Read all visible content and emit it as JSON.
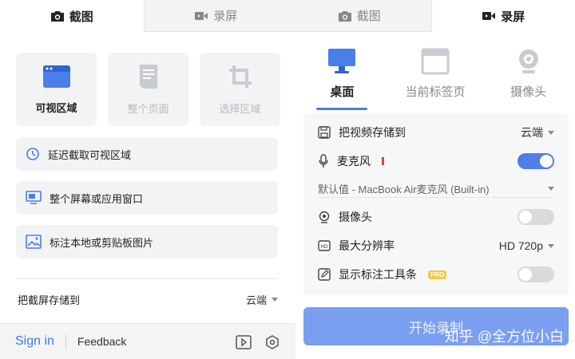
{
  "top_tabs": [
    {
      "label": "截图",
      "icon": "camera-icon"
    },
    {
      "label": "录屏",
      "icon": "video-icon"
    },
    {
      "label": "截图",
      "icon": "camera-icon"
    },
    {
      "label": "录屏",
      "icon": "video-icon"
    }
  ],
  "screenshot": {
    "modes": [
      {
        "label": "可视区域",
        "icon": "browser-window-icon",
        "state": "active"
      },
      {
        "label": "整个页面",
        "icon": "full-page-icon",
        "state": "disabled"
      },
      {
        "label": "选择区域",
        "icon": "crop-icon",
        "state": "disabled"
      }
    ],
    "options": [
      {
        "label": "延迟截取可视区域",
        "icon": "timer-icon"
      },
      {
        "label": "整个屏幕或应用窗口",
        "icon": "monitor-icon"
      },
      {
        "label": "标注本地或剪贴板图片",
        "icon": "image-icon"
      }
    ],
    "save_label": "把截屏存储到",
    "save_value": "云端"
  },
  "footer": {
    "signin": "Sign in",
    "feedback": "Feedback"
  },
  "record": {
    "tabs": [
      {
        "label": "桌面",
        "icon": "desktop-icon"
      },
      {
        "label": "当前标签页",
        "icon": "browser-tab-icon"
      },
      {
        "label": "摄像头",
        "icon": "webcam-icon"
      }
    ],
    "save_label": "把视频存储到",
    "save_value": "云端",
    "mic_label": "麦克风",
    "mic_on": true,
    "mic_device": "默认值 - MacBook Air麦克风 (Built-in)",
    "camera_label": "摄像头",
    "camera_on": false,
    "resolution_label": "最大分辨率",
    "resolution_value": "HD 720p",
    "annotation_label": "显示标注工具条",
    "annotation_badge": "PRO",
    "annotation_on": false,
    "start_label": "开始录制"
  },
  "watermark": "知乎 @全方位小白",
  "colors": {
    "accent": "#4f7ee6",
    "start_button": "#7b9ff0",
    "link": "#3c7be6"
  }
}
